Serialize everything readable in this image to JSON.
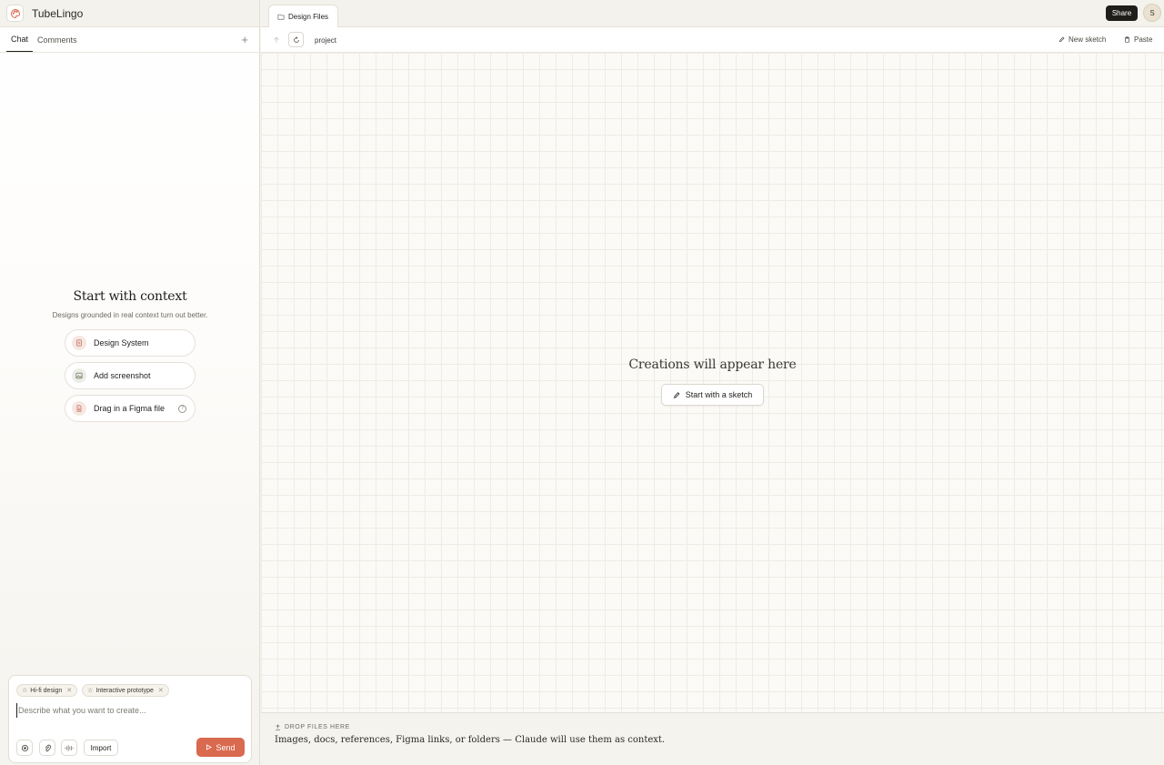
{
  "app": {
    "title": "TubeLingo",
    "logo_icon": "palette-icon"
  },
  "left_tabs": [
    {
      "label": "Chat",
      "active": true
    },
    {
      "label": "Comments",
      "active": false
    }
  ],
  "context": {
    "title": "Start with context",
    "subtitle": "Designs grounded in real context turn out better.",
    "items": [
      {
        "label": "Design System",
        "icon": "design-system-icon",
        "color": "#f6e7e2"
      },
      {
        "label": "Add screenshot",
        "icon": "image-icon",
        "color": "#ebeee7"
      },
      {
        "label": "Drag in a Figma file",
        "icon": "file-icon",
        "color": "#f6e7e2",
        "help": "?"
      }
    ]
  },
  "composer": {
    "chips": [
      {
        "label": "Hi-fi design"
      },
      {
        "label": "Interactive prototype"
      }
    ],
    "placeholder": "Describe what you want to create...",
    "import_label": "Import",
    "send_label": "Send",
    "send_color": "#d9694f"
  },
  "header": {
    "file_tab": "Design Files",
    "share_label": "Share",
    "avatar_initial": "S"
  },
  "toolbar": {
    "breadcrumb": "project",
    "new_sketch_label": "New sketch",
    "paste_label": "Paste"
  },
  "canvas": {
    "empty_title": "Creations will appear here",
    "sketch_button": "Start with a sketch"
  },
  "dropzone": {
    "label": "DROP FILES HERE",
    "text": "Images, docs, references, Figma links, or folders — Claude will use them as context."
  }
}
